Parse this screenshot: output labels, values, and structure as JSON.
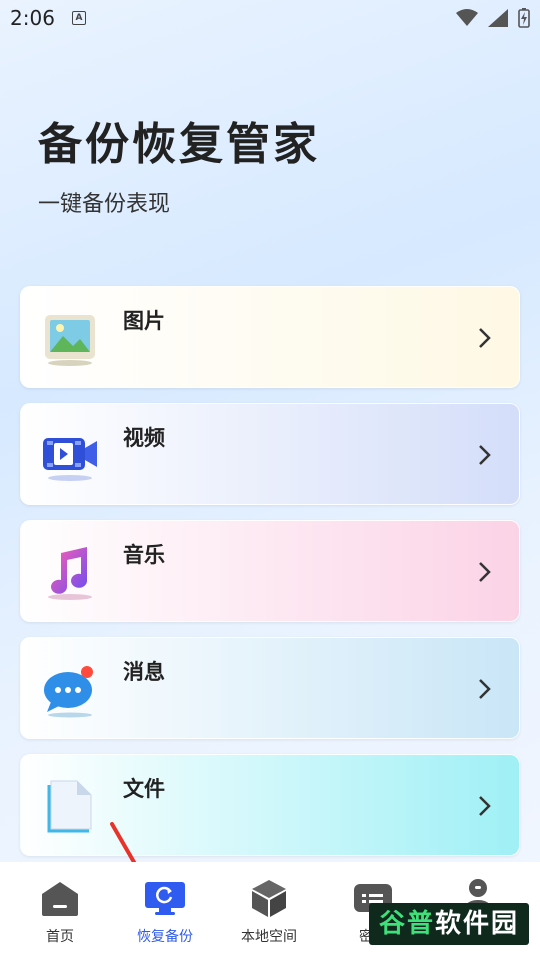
{
  "status_bar": {
    "time": "2:06",
    "a_badge": "A"
  },
  "header": {
    "title": "备份恢复管家",
    "subtitle": "一键备份表现"
  },
  "categories": [
    {
      "label": "图片",
      "icon": "picture-icon",
      "color": "#fdf6df"
    },
    {
      "label": "视频",
      "icon": "video-icon",
      "color": "#d8e2fb"
    },
    {
      "label": "音乐",
      "icon": "music-icon",
      "color": "#fbd6e8"
    },
    {
      "label": "消息",
      "icon": "message-icon",
      "color": "#cde8f7"
    },
    {
      "label": "文件",
      "icon": "file-icon",
      "color": "#a9f1f6"
    }
  ],
  "bottom_nav": [
    {
      "label": "首页",
      "icon": "home-icon"
    },
    {
      "label": "恢复备份",
      "icon": "monitor-restore-icon",
      "active": true
    },
    {
      "label": "本地空间",
      "icon": "cube-icon"
    },
    {
      "label": "密码",
      "icon": "password-icon"
    },
    {
      "label": "",
      "icon": "profile-icon"
    }
  ],
  "watermark": {
    "part1": "谷普",
    "part2": "软件园"
  },
  "colors": {
    "accent": "#2f5bf0",
    "background": "#eaf3ff"
  }
}
